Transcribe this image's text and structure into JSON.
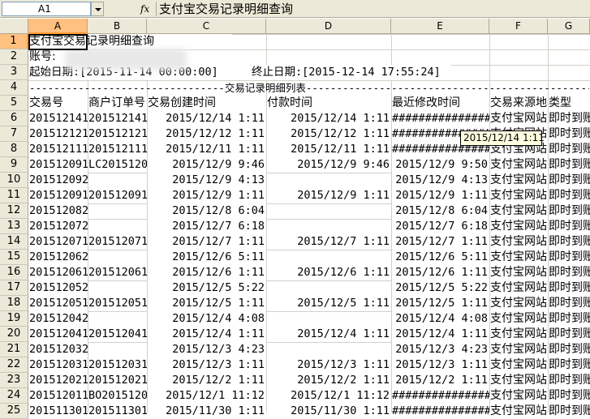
{
  "formula_bar": {
    "name_box": "A1",
    "fx": "fx",
    "formula": "支付宝交易记录明细查询"
  },
  "columns": [
    "A",
    "B",
    "C",
    "D",
    "E",
    "F",
    "G"
  ],
  "rows": [
    "1",
    "2",
    "3",
    "4",
    "5",
    "6",
    "7",
    "8",
    "9",
    "10",
    "11",
    "12",
    "13",
    "14",
    "15",
    "16",
    "17",
    "18",
    "19",
    "20",
    "21",
    "22",
    "23",
    "24",
    "25"
  ],
  "sheet": {
    "title": "支付宝交易记录明细查询",
    "account_label": "账号:",
    "start_date": "起始日期:[2015-11-14 00:00:00]",
    "end_date": "终止日期:[2015-12-14 17:55:24]",
    "divider": "--------------------------------交易记录明细列表--------------------------------------------------",
    "headers": [
      "交易号",
      "商户订单号",
      "交易创建时间",
      "付款时间",
      "最近修改时间",
      "交易来源地",
      "类型"
    ],
    "records": [
      [
        "201512141",
        "201512141",
        "2015/12/14 1:11",
        "2015/12/14 1:11",
        "###############",
        "支付宝网站",
        "即时到账"
      ],
      [
        "201512121",
        "201512121",
        "2015/12/12 1:11",
        "2015/12/12 1:11",
        "###############",
        "支付宝网站",
        "即时到账"
      ],
      [
        "201512111",
        "201512111",
        "2015/12/11 1:11",
        "2015/12/11 1:11",
        "###############",
        "支付宝网站",
        "即时到账"
      ],
      [
        "201512091",
        "LC2015120",
        "2015/12/9 9:46",
        "2015/12/9 9:46",
        "2015/12/9 9:50",
        "支付宝网站",
        "即时到账"
      ],
      [
        "201512092",
        "",
        "2015/12/9 4:13",
        "",
        "2015/12/9 4:13",
        "支付宝网站",
        "即时到账"
      ],
      [
        "201512091",
        "201512091",
        "2015/12/9 1:11",
        "2015/12/9 1:11",
        "2015/12/9 1:11",
        "支付宝网站",
        "即时到账"
      ],
      [
        "201512082",
        "",
        "2015/12/8 6:04",
        "",
        "2015/12/8 6:04",
        "支付宝网站",
        "即时到账"
      ],
      [
        "201512072",
        "",
        "2015/12/7 6:18",
        "",
        "2015/12/7 6:18",
        "支付宝网站",
        "即时到账"
      ],
      [
        "201512071",
        "201512071",
        "2015/12/7 1:11",
        "2015/12/7 1:11",
        "2015/12/7 1:11",
        "支付宝网站",
        "即时到账"
      ],
      [
        "201512062",
        "",
        "2015/12/6 5:11",
        "",
        "2015/12/6 5:11",
        "支付宝网站",
        "即时到账"
      ],
      [
        "201512061",
        "201512061",
        "2015/12/6 1:11",
        "2015/12/6 1:11",
        "2015/12/6 1:11",
        "支付宝网站",
        "即时到账"
      ],
      [
        "201512052",
        "",
        "2015/12/5 5:22",
        "",
        "2015/12/5 5:22",
        "支付宝网站",
        "即时到账"
      ],
      [
        "201512051",
        "201512051",
        "2015/12/5 1:11",
        "2015/12/5 1:11",
        "2015/12/5 1:11",
        "支付宝网站",
        "即时到账"
      ],
      [
        "201512042",
        "",
        "2015/12/4 4:08",
        "",
        "2015/12/4 4:08",
        "支付宝网站",
        "即时到账"
      ],
      [
        "201512041",
        "201512041",
        "2015/12/4 1:11",
        "2015/12/4 1:11",
        "2015/12/4 1:11",
        "支付宝网站",
        "即时到账"
      ],
      [
        "201512032",
        "",
        "2015/12/3 4:23",
        "",
        "2015/12/3 4:23",
        "支付宝网站",
        "即时到账"
      ],
      [
        "201512031",
        "201512031",
        "2015/12/3 1:11",
        "2015/12/3 1:11",
        "2015/12/3 1:11",
        "支付宝网站",
        "即时到账"
      ],
      [
        "201512021",
        "201512021",
        "2015/12/2 1:11",
        "2015/12/2 1:11",
        "2015/12/2 1:11",
        "支付宝网站",
        "即时到账"
      ],
      [
        "201512011",
        "BO2015120",
        "2015/12/1 11:12",
        "2015/12/1 11:12",
        "###############",
        "支付宝网站",
        "即时到账"
      ],
      [
        "201511301",
        "201511301",
        "2015/11/30 1:11",
        "2015/11/30 1:11",
        "###############",
        "支付宝网站",
        "即时到账"
      ]
    ]
  },
  "tooltip": "2015/12/14 1:11"
}
